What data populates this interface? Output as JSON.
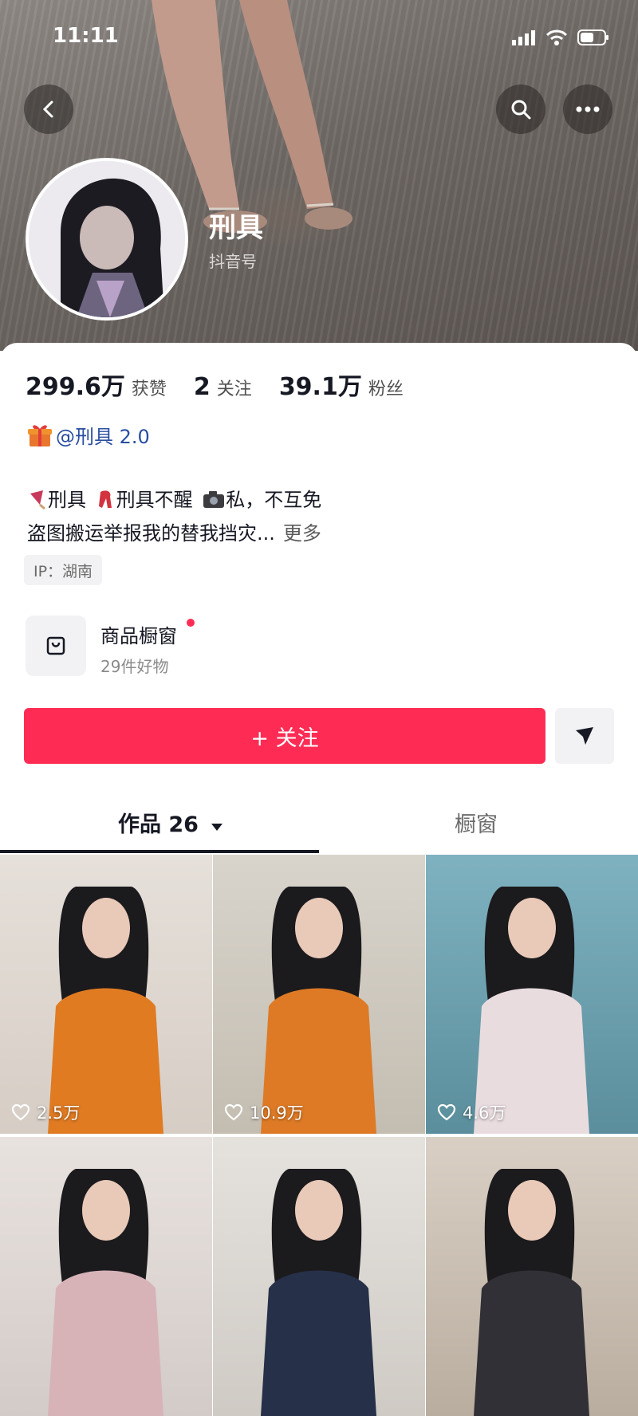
{
  "status_bar": {
    "time": "11:11"
  },
  "profile": {
    "name": "刑具",
    "id_label": "抖音号"
  },
  "stats": [
    {
      "value": "299.6万",
      "label": "获赞"
    },
    {
      "value": "2",
      "label": "关注"
    },
    {
      "value": "39.1万",
      "label": "粉丝"
    }
  ],
  "associated_account": "@刑具 2.0",
  "bio": {
    "line1_a": "刑具",
    "line1_b": "刑具不醒",
    "line1_c": "私，不互免",
    "line2": "盗图搬运举报我的替我挡灾...",
    "more": "更多"
  },
  "ip": "IP：湖南",
  "shop": {
    "title": "商品橱窗",
    "subtitle": "29件好物"
  },
  "actions": {
    "follow": "+ 关注"
  },
  "tabs": {
    "works": "作品 26",
    "showcase": "橱窗"
  },
  "videos": [
    {
      "likes": "2.5万",
      "colors": [
        "#e6e0da",
        "#d6cdc5"
      ],
      "outfit": "#e07b22"
    },
    {
      "likes": "10.9万",
      "colors": [
        "#d8d4cc",
        "#c4bdb1"
      ],
      "outfit": "#de7a25"
    },
    {
      "likes": "4.6万",
      "colors": [
        "#7fb2c0",
        "#5b8e9c"
      ],
      "outfit": "#e9dcdf"
    },
    {
      "likes": "",
      "colors": [
        "#e8e2de",
        "#d3cbc7"
      ],
      "outfit": "#d7b3b8"
    },
    {
      "likes": "",
      "colors": [
        "#e5e2de",
        "#cfcac4"
      ],
      "outfit": "#263048"
    },
    {
      "likes": "",
      "colors": [
        "#d9cfc4",
        "#b9ad9f"
      ],
      "outfit": "#303036"
    }
  ]
}
